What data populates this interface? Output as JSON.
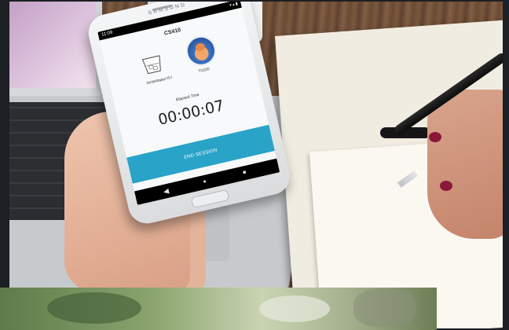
{
  "phone": {
    "brand": "SAMSUNG",
    "status_time": "11:09",
    "status_icons": "▾ ▴ ▮",
    "app": {
      "title": "CS410",
      "participant_left": "SmileWaiter757",
      "participant_right": "TD220",
      "elapsed_label": "Elapsed Time",
      "elapsed_value": "00:00:07",
      "end_button_label": "END SESSION"
    },
    "nav": {
      "back_icon": "◀",
      "home_icon": "●",
      "recents_icon": "■"
    }
  },
  "colors": {
    "accent": "#2aa3c8",
    "nail_polish": "#8a1838"
  }
}
